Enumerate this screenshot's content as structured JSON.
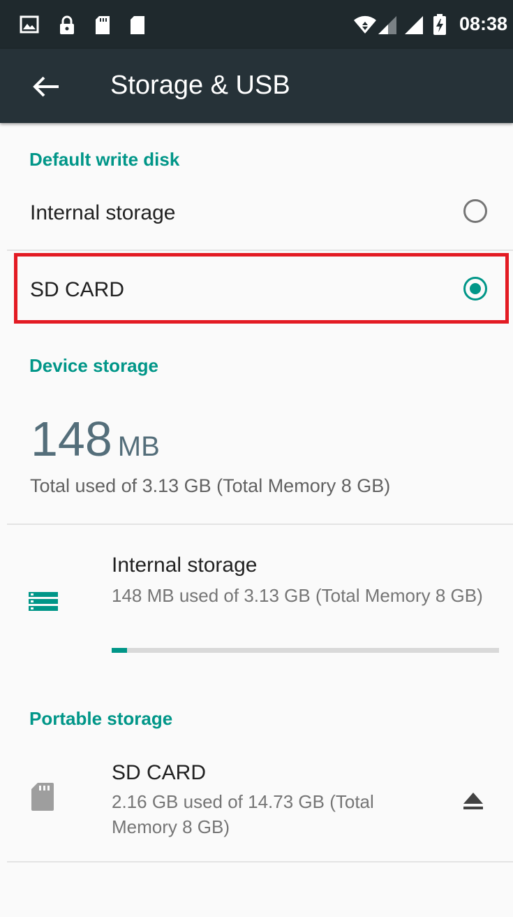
{
  "status_bar": {
    "time": "08:38",
    "icons": [
      "image-icon",
      "lock-icon",
      "sim-card-icon",
      "sd-card-icon",
      "wifi-icon",
      "signal-icon",
      "signal-icon",
      "battery-icon"
    ]
  },
  "toolbar": {
    "back_icon": "arrow-left-icon",
    "title": "Storage & USB"
  },
  "default_write_disk": {
    "header": "Default write disk",
    "options": [
      {
        "label": "Internal storage",
        "selected": false
      },
      {
        "label": "SD CARD",
        "selected": true
      }
    ]
  },
  "device_storage": {
    "header": "Device storage",
    "used_value": "148",
    "used_unit": "MB",
    "summary": "Total used of 3.13 GB (Total Memory 8 GB)",
    "internal": {
      "icon": "storage-icon",
      "title": "Internal storage",
      "detail": "148 MB used of 3.13 GB (Total Memory 8 GB)",
      "usage_percent": 4
    }
  },
  "portable_storage": {
    "header": "Portable storage",
    "sd_card": {
      "icon": "sd-card-icon",
      "title": "SD CARD",
      "detail": "2.16 GB used of 14.73 GB (Total Memory 8 GB)",
      "action_icon": "eject-icon"
    }
  },
  "colors": {
    "accent": "#009688",
    "toolbar": "#263238",
    "status_bar": "#1f292d",
    "highlight": "#e31b23",
    "big_number": "#546e7a"
  }
}
